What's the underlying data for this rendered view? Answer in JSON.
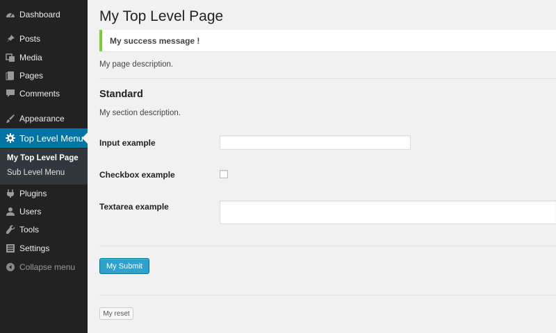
{
  "sidebar": {
    "items": [
      {
        "label": "Dashboard",
        "icon": "dashboard-icon"
      },
      {
        "label": "Posts",
        "icon": "pushpin-icon"
      },
      {
        "label": "Media",
        "icon": "media-icon"
      },
      {
        "label": "Pages",
        "icon": "pages-icon"
      },
      {
        "label": "Comments",
        "icon": "comment-icon"
      },
      {
        "label": "Appearance",
        "icon": "paintbrush-icon"
      },
      {
        "label": "Top Level Menu",
        "icon": "gear-icon"
      },
      {
        "label": "Plugins",
        "icon": "plugin-icon"
      },
      {
        "label": "Users",
        "icon": "user-icon"
      },
      {
        "label": "Tools",
        "icon": "wrench-icon"
      },
      {
        "label": "Settings",
        "icon": "settings-icon"
      },
      {
        "label": "Collapse menu",
        "icon": "collapse-icon"
      }
    ],
    "submenu": [
      {
        "label": "My Top Level Page"
      },
      {
        "label": "Sub Level Menu"
      }
    ]
  },
  "main": {
    "title": "My Top Level Page",
    "notice": "My success message !",
    "description": "My page description.",
    "section": {
      "title": "Standard",
      "description": "My section description."
    },
    "fields": {
      "input_label": "Input example",
      "input_value": "",
      "checkbox_label": "Checkbox example",
      "checkbox_checked": false,
      "textarea_label": "Textarea example",
      "textarea_value": ""
    },
    "submit_label": "My Submit",
    "reset_label": "My reset"
  },
  "colors": {
    "sidebar_bg": "#222222",
    "active_menu": "#0074a2",
    "primary_button": "#2ea2cc",
    "notice_success": "#7ad03a",
    "page_bg": "#f1f1f1"
  }
}
